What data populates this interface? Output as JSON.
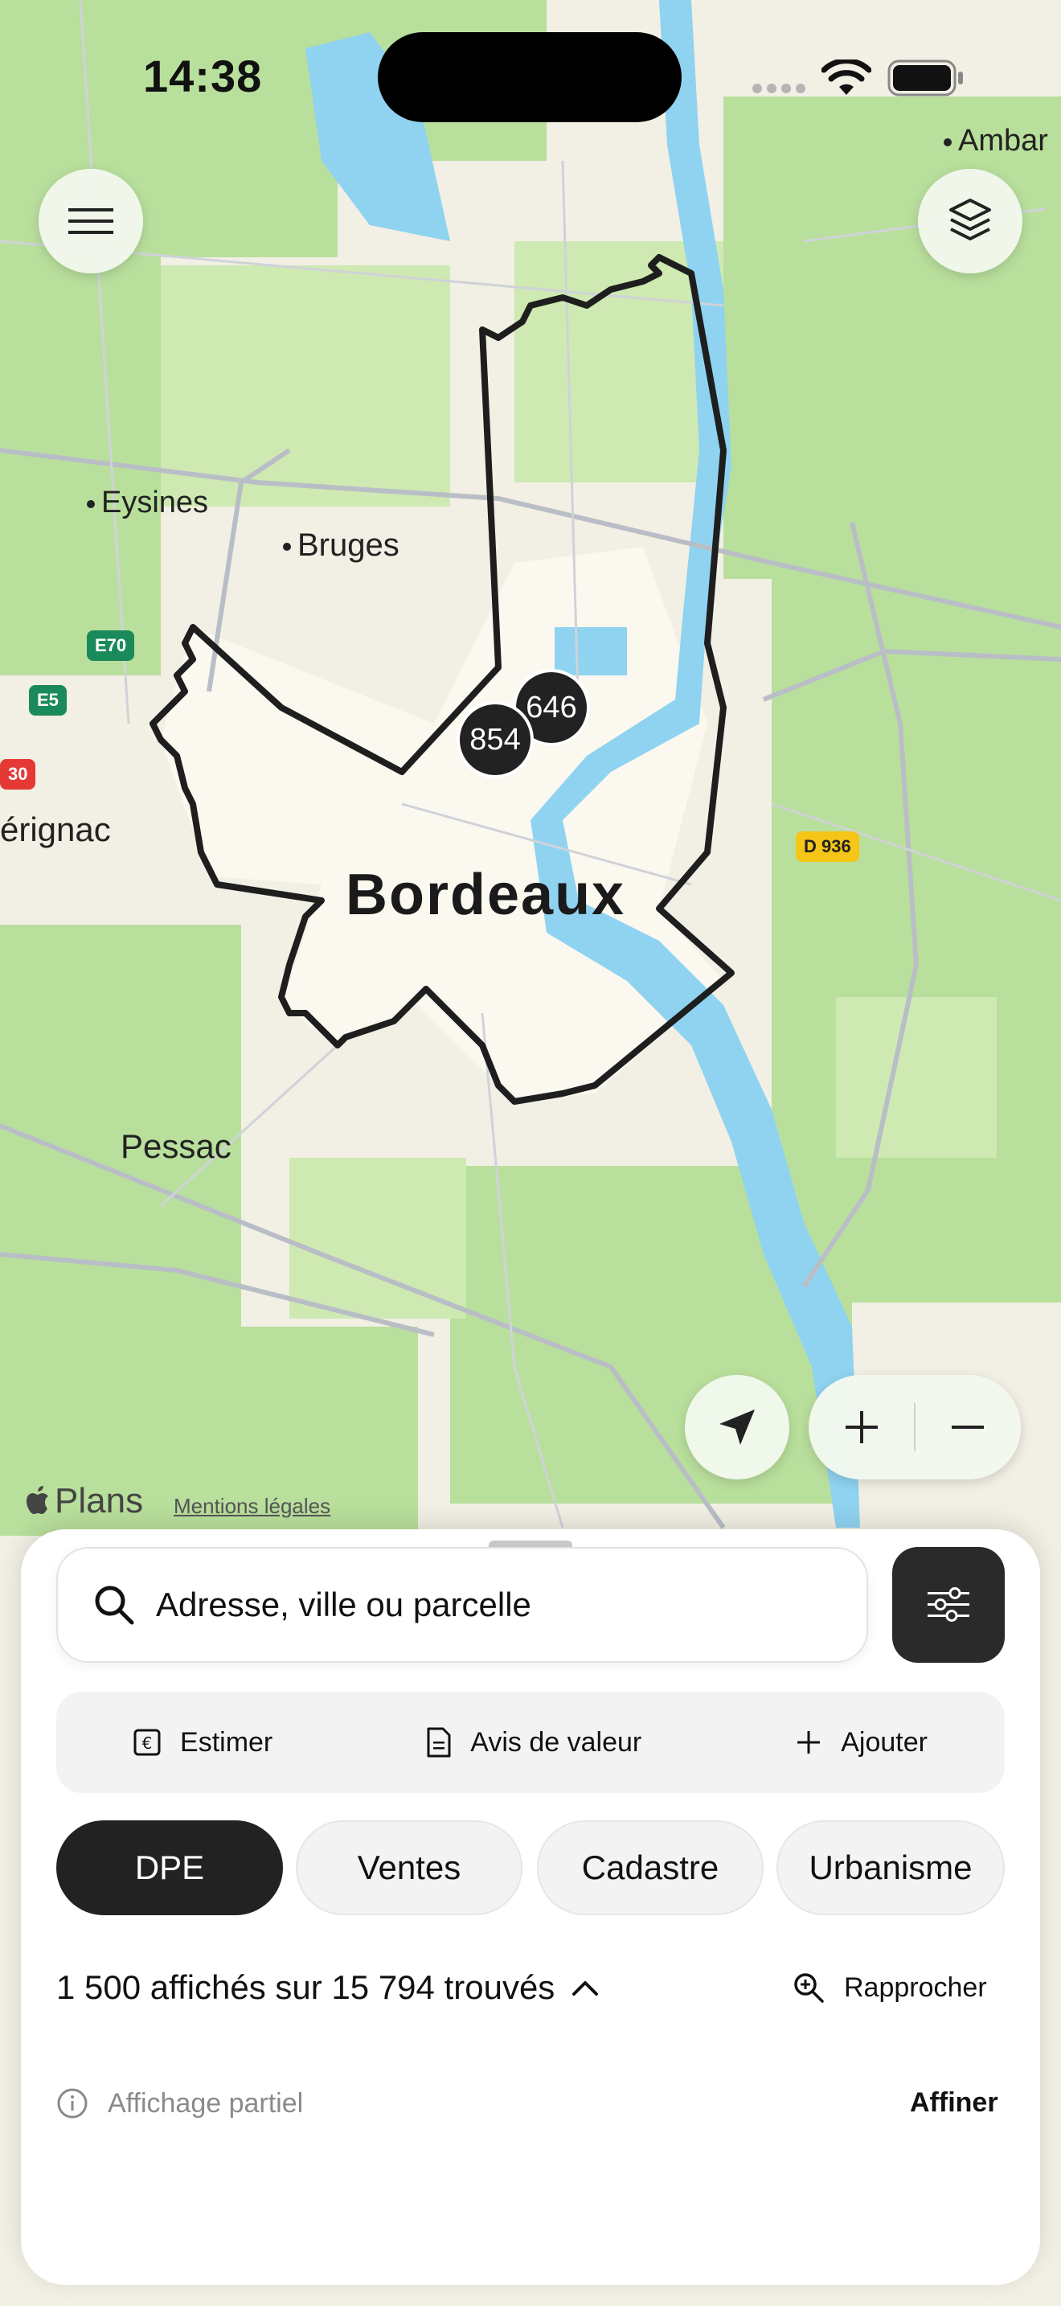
{
  "status_bar": {
    "time": "14:38"
  },
  "map": {
    "city": "Bordeaux",
    "places": [
      "Eysines",
      "Bruges",
      "Ambar",
      "érignac",
      "Pessac"
    ],
    "shields": [
      {
        "label": "E70",
        "color": "#1b8a5a"
      },
      {
        "label": "E5",
        "color": "#1b8a5a"
      },
      {
        "label": "D 936",
        "color": "#f5c518"
      },
      {
        "label": "30",
        "color": "#e53935"
      }
    ],
    "clusters": [
      "646",
      "854"
    ],
    "attribution": {
      "brand": "Plans",
      "legal": "Mentions légales"
    }
  },
  "search": {
    "placeholder": "Adresse, ville ou parcelle"
  },
  "actions": [
    {
      "label": "Estimer",
      "icon": "euro-icon"
    },
    {
      "label": "Avis de valeur",
      "icon": "document-icon"
    },
    {
      "label": "Ajouter",
      "icon": "plus-icon"
    }
  ],
  "tabs": [
    "DPE",
    "Ventes",
    "Cadastre",
    "Urbanisme"
  ],
  "results": {
    "count_text": "1 500 affichés sur 15 794 trouvés",
    "zoom_label": "Rapprocher",
    "partial_label": "Affichage partiel",
    "refine_label": "Affiner"
  },
  "colors": {
    "accent": "#222222",
    "water": "#8fd3f0",
    "park": "#b9df9c"
  }
}
